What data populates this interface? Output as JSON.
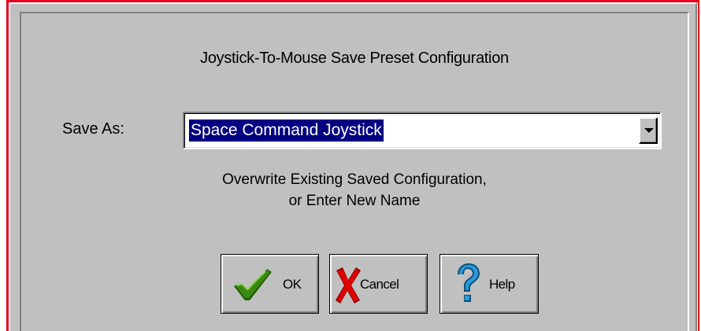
{
  "dialog": {
    "title": "Joystick-To-Mouse Save Preset Configuration",
    "save_as_label": "Save As:",
    "save_as_value": "Space Command Joystick",
    "hint_line1": "Overwrite Existing Saved Configuration,",
    "hint_line2": "or Enter New Name"
  },
  "buttons": {
    "ok_label": "OK",
    "cancel_label": "Cancel",
    "help_label": "Help"
  },
  "icons": {
    "ok": "checkmark-icon",
    "cancel": "x-mark-icon",
    "help": "question-mark-icon",
    "dropdown": "chevron-down-icon"
  },
  "colors": {
    "frame_border": "#e8001c",
    "dialog_face": "#c0c0c0",
    "selection": "#000080",
    "checkmark": "#3a8a10",
    "x_mark": "#e00000",
    "question_mark": "#2a9ad8"
  }
}
